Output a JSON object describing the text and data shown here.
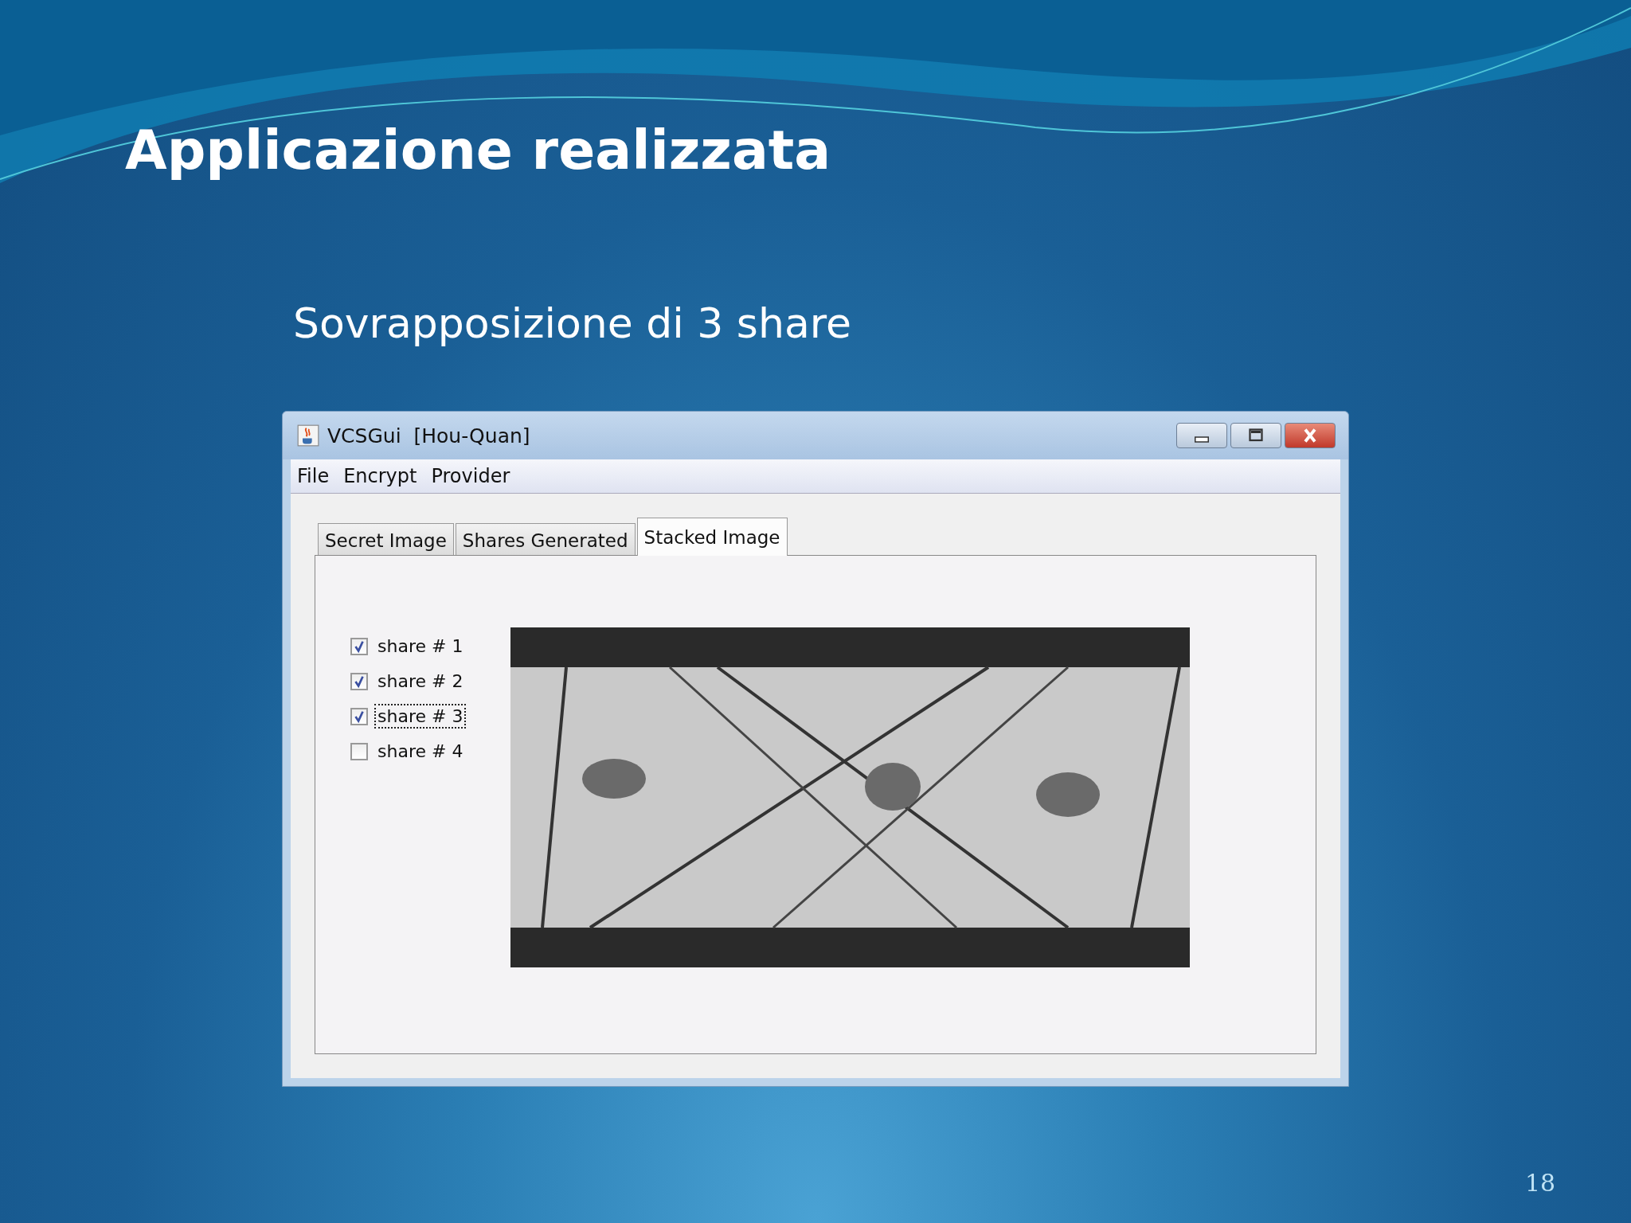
{
  "slide": {
    "title": "Applicazione realizzata",
    "subtitle": "Sovrapposizione di 3 share",
    "page_number": "18"
  },
  "window": {
    "title": "VCSGui  [Hou-Quan]"
  },
  "menu": [
    "File",
    "Encrypt",
    "Provider"
  ],
  "tabs": [
    {
      "label": "Secret Image",
      "selected": false
    },
    {
      "label": "Shares Generated",
      "selected": false
    },
    {
      "label": "Stacked Image",
      "selected": true
    }
  ],
  "shares": [
    {
      "label": "share # 1",
      "checked": true,
      "focused": false
    },
    {
      "label": "share # 2",
      "checked": true,
      "focused": false
    },
    {
      "label": "share # 3",
      "checked": true,
      "focused": true
    },
    {
      "label": "share # 4",
      "checked": false,
      "focused": false
    }
  ],
  "stacked_image": {
    "kind": "picture"
  }
}
